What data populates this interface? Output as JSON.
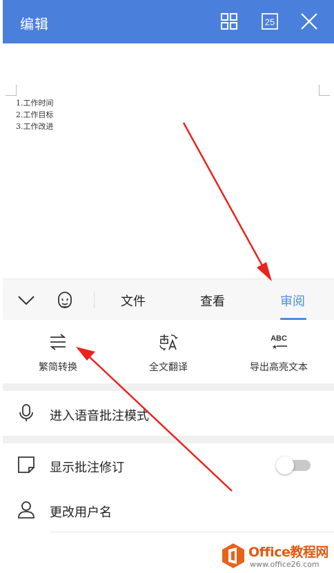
{
  "header": {
    "title": "编辑",
    "page_count": "25",
    "icons": [
      "grid-icon",
      "page-count-icon",
      "close-icon"
    ],
    "bg_color": "#4a7fdc"
  },
  "document": {
    "lines": [
      "1.工作时间",
      "2.工作目标",
      "3.工作改进"
    ]
  },
  "tabbar": {
    "icons": [
      "chevron-down-icon",
      "face-icon"
    ],
    "tabs": [
      {
        "label": "文件",
        "active": false
      },
      {
        "label": "查看",
        "active": false
      },
      {
        "label": "审阅",
        "active": true
      }
    ],
    "active_color": "#4a8be8"
  },
  "tools": [
    {
      "label": "繁简转换",
      "icon": "convert-icon"
    },
    {
      "label": "全文翻译",
      "icon": "translate-icon"
    },
    {
      "label": "导出高亮文本",
      "icon": "abc-export-icon",
      "icon_text": "ABC"
    }
  ],
  "settings": [
    {
      "label": "进入语音批注模式",
      "icon": "microphone-icon"
    },
    {
      "label": "显示批注修订",
      "icon": "note-icon",
      "toggle_on": false
    },
    {
      "label": "更改用户名",
      "icon": "user-icon"
    }
  ],
  "watermark": {
    "title": "Office教程网",
    "subtitle": "www.office26.com",
    "color": "#e05a10"
  }
}
